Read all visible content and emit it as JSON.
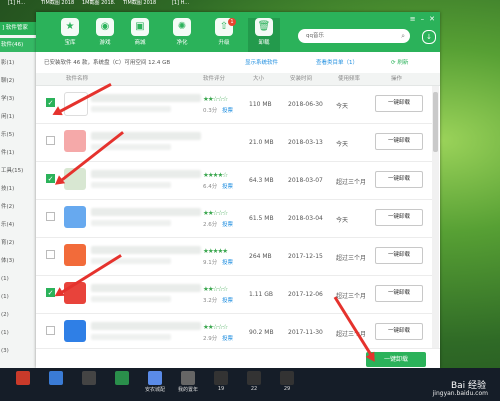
{
  "desktop": {
    "top_icons": [
      "[1] H...",
      "TIM截图 20180723...",
      "1M截图 2018...",
      "TIM截图 20180726...",
      "[1] H..."
    ],
    "taskbar_items": [
      "",
      "",
      "",
      "",
      "安农城配",
      "我的置年",
      "19",
      "22",
      "29"
    ],
    "watermark": "Bai 经验",
    "watermark_url": "jingyan.baidu.com"
  },
  "sidebar": {
    "title": "] 软件管家",
    "categories": [
      "软件(46)",
      "影(1)",
      "聊(2)",
      "学(3)",
      "闲(1)",
      "乐(5)",
      "件(1)",
      "工具(15)",
      "技(1)",
      "件(2)",
      "乐(4)",
      "育(2)",
      "体(3)",
      "(1)",
      "(1)",
      "(2)",
      "(1)",
      "(3)"
    ]
  },
  "window": {
    "nav": [
      {
        "label": "宝库",
        "icon": "★"
      },
      {
        "label": "游戏",
        "icon": "◉"
      },
      {
        "label": "商城",
        "icon": "▣"
      },
      {
        "label": "净化",
        "icon": "✺"
      },
      {
        "label": "升级",
        "icon": "⇧",
        "badge": "1"
      },
      {
        "label": "卸载",
        "icon": "🗑"
      }
    ],
    "search_placeholder": "qq音乐",
    "info": {
      "installed": "已安装软件 46 款，系统盘（C）可用空间 12.4 GB",
      "show_system": "显示系统软件",
      "group_view": "查看类目单（1）",
      "refresh": "⟳ 刷新"
    },
    "headers": [
      "软件名称",
      "软件评分",
      "大小",
      "安装时间",
      "使用频率",
      "操作"
    ],
    "rows": [
      {
        "checked": true,
        "stars": "★★☆☆☆",
        "score": "0.3分",
        "vote": "投票",
        "size": "110 MB",
        "date": "2018-06-30",
        "freq": "今天",
        "btn": "一键卸载",
        "color": "#ffffff"
      },
      {
        "checked": false,
        "stars": "",
        "score": "",
        "vote": "",
        "size": "21.0 MB",
        "date": "2018-03-13",
        "freq": "今天",
        "btn": "一键卸载",
        "color": "#f5a9a9"
      },
      {
        "checked": true,
        "stars": "★★★★☆",
        "score": "6.4分",
        "vote": "投票",
        "size": "64.3 MB",
        "date": "2018-03-07",
        "freq": "超过三个月",
        "btn": "一键卸载",
        "color": "#d8e7d2"
      },
      {
        "checked": false,
        "stars": "★★☆☆☆",
        "score": "2.6分",
        "vote": "投票",
        "size": "61.5 MB",
        "date": "2018-03-04",
        "freq": "今天",
        "btn": "一键卸载",
        "color": "#67a9ef"
      },
      {
        "checked": false,
        "stars": "★★★★★",
        "score": "9.1分",
        "vote": "投票",
        "size": "264 MB",
        "date": "2017-12-15",
        "freq": "超过三个月",
        "btn": "一键卸载",
        "color": "#f26b3a"
      },
      {
        "checked": true,
        "stars": "★★☆☆☆",
        "score": "3.2分",
        "vote": "投票",
        "size": "1.11 GB",
        "date": "2017-12-06",
        "freq": "超过三个月",
        "btn": "一键卸载",
        "color": "#e8433b"
      },
      {
        "checked": false,
        "stars": "★★☆☆☆",
        "score": "2.9分",
        "vote": "投票",
        "size": "90.2 MB",
        "date": "2017-11-30",
        "freq": "超过三个月",
        "btn": "一键卸载",
        "color": "#2f7fe6"
      }
    ],
    "uninstall_all": "一键卸载"
  }
}
